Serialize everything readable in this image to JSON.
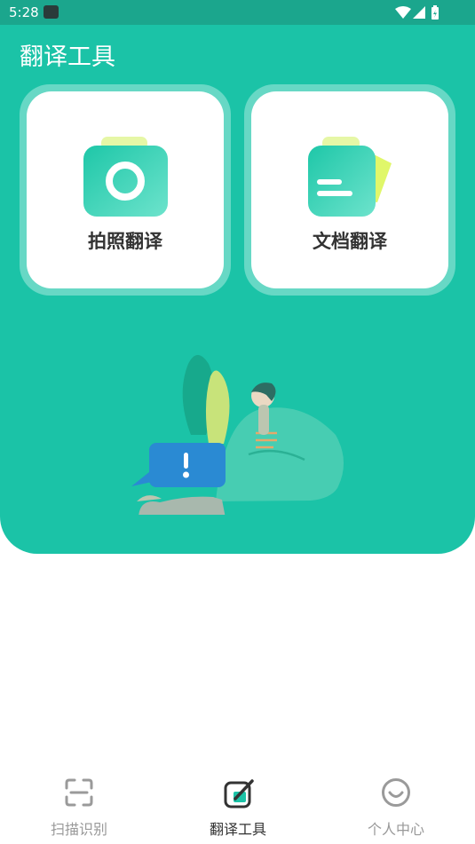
{
  "status_bar": {
    "time": "5:28",
    "icons": [
      "notification-app-icon",
      "wifi-icon",
      "signal-icon",
      "battery-icon"
    ]
  },
  "header": {
    "title": "翻译工具"
  },
  "cards": [
    {
      "label": "拍照翻译",
      "icon": "camera-icon"
    },
    {
      "label": "文档翻译",
      "icon": "document-icon"
    }
  ],
  "illustration": {
    "name": "person-with-speech-bubble-illustration"
  },
  "bottom_nav": {
    "items": [
      {
        "label": "扫描识别",
        "icon": "scan-icon",
        "active": false
      },
      {
        "label": "翻译工具",
        "icon": "translate-edit-icon",
        "active": true
      },
      {
        "label": "个人中心",
        "icon": "smiley-icon",
        "active": false
      }
    ]
  },
  "colors": {
    "primary": "#1bc3a7",
    "status_bar": "#1ba68d",
    "card_ring": "#67d8c5",
    "nav_active": "#333333",
    "nav_inactive": "#999999"
  }
}
